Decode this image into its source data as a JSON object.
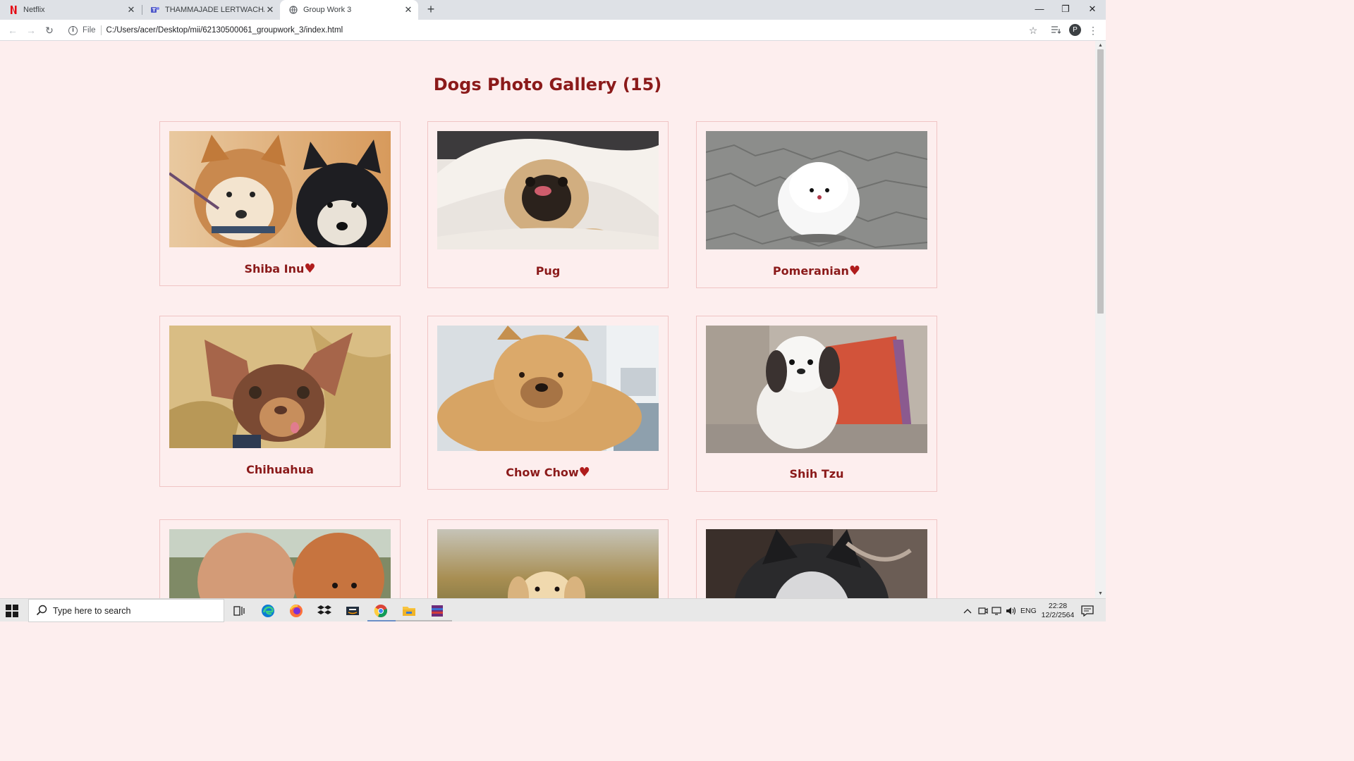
{
  "browser": {
    "tabs": [
      {
        "label": "Netflix",
        "icon": "netflix-icon",
        "active": false
      },
      {
        "label": "THAMMAJADE LERTWACHARA |",
        "icon": "teams-icon",
        "active": false
      },
      {
        "label": "Group Work 3",
        "icon": "globe-icon",
        "active": true
      }
    ],
    "new_tab_label": "+",
    "scheme_label": "File",
    "url": "C:/Users/acer/Desktop/mii/62130500061_groupwork_3/index.html",
    "profile_initial": "P"
  },
  "page": {
    "title": "Dogs Photo Gallery (15)",
    "heart": "♥",
    "dogs": [
      {
        "name": "Shiba Inu",
        "favorite": true
      },
      {
        "name": "Pug",
        "favorite": false
      },
      {
        "name": "Pomeranian",
        "favorite": true
      },
      {
        "name": "Chihuahua",
        "favorite": false
      },
      {
        "name": "Chow Chow",
        "favorite": true
      },
      {
        "name": "Shih Tzu",
        "favorite": false
      },
      {
        "name": "",
        "favorite": false
      },
      {
        "name": "",
        "favorite": false
      },
      {
        "name": "",
        "favorite": false
      }
    ]
  },
  "taskbar": {
    "search_placeholder": "Type here to search",
    "language": "ENG",
    "time": "22:28",
    "date": "12/2/2564"
  },
  "colors": {
    "page_background": "#fdeeee",
    "title_color": "#8b1a1a",
    "card_border": "#f0c4c4"
  }
}
